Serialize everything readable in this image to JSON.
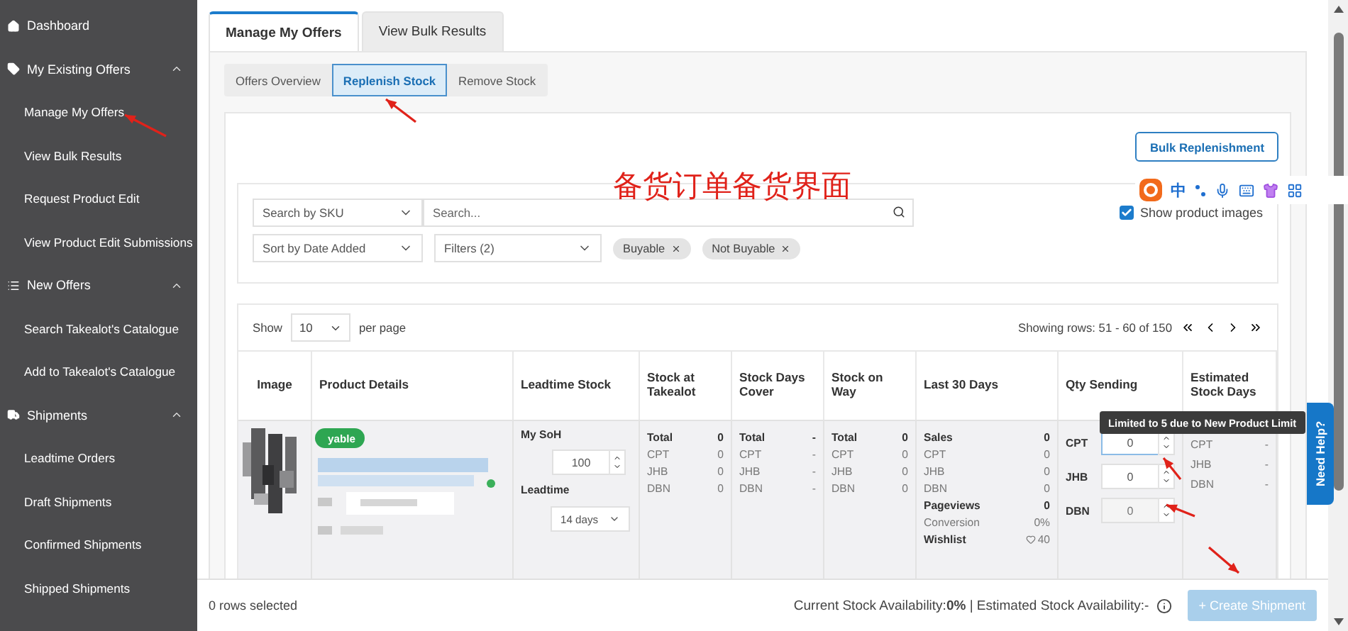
{
  "sidebar": {
    "items": [
      {
        "label": "Dashboard"
      },
      {
        "label": "My Existing Offers",
        "expanded": true,
        "children": [
          {
            "label": "Manage My Offers"
          },
          {
            "label": "View Bulk Results"
          },
          {
            "label": "Request Product Edit"
          },
          {
            "label": "View Product Edit Submissions"
          }
        ]
      },
      {
        "label": "New Offers",
        "expanded": true,
        "children": [
          {
            "label": "Search Takealot's Catalogue"
          },
          {
            "label": "Add to Takealot's Catalogue"
          }
        ]
      },
      {
        "label": "Shipments",
        "expanded": true,
        "children": [
          {
            "label": "Leadtime Orders"
          },
          {
            "label": "Draft Shipments"
          },
          {
            "label": "Confirmed Shipments"
          },
          {
            "label": "Shipped Shipments"
          }
        ]
      }
    ]
  },
  "tabs": [
    {
      "label": "Manage My Offers",
      "selected": true
    },
    {
      "label": "View Bulk Results",
      "selected": false
    }
  ],
  "subtabs": [
    {
      "label": "Offers Overview",
      "selected": false
    },
    {
      "label": "Replenish Stock",
      "selected": true
    },
    {
      "label": "Remove Stock",
      "selected": false
    }
  ],
  "bulk_button": "Bulk Replenishment",
  "annotation": "备货订单备货界面",
  "ime_toolbar": {
    "label": "中"
  },
  "filters": {
    "search_by": "Search by SKU",
    "search_placeholder": "Search...",
    "sort": "Sort by Date Added",
    "filter": "Filters (2)",
    "chips": [
      "Buyable",
      "Not Buyable"
    ],
    "show_images": {
      "label": "Show product images",
      "checked": true
    }
  },
  "pagination": {
    "show": "Show",
    "per_page_value": "10",
    "per_page": "per page",
    "rows_info": "Showing rows: 51 - 60 of 150"
  },
  "table": {
    "columns": [
      "Image",
      "Product Details",
      "Leadtime Stock",
      "Stock at Takealot",
      "Stock Days Cover",
      "Stock on Way",
      "Last 30 Days",
      "Qty Sending",
      "Estimated Stock Days"
    ],
    "rows": [
      {
        "badge": "yable",
        "soh_label": "My SoH",
        "soh": "100",
        "leadtime_label": "Leadtime",
        "leadtime": "14 days",
        "stock_at_takealot": [
          {
            "label": "Total",
            "value": "0",
            "bold": true
          },
          {
            "label": "CPT",
            "value": "0",
            "bold": false
          },
          {
            "label": "JHB",
            "value": "0",
            "bold": false
          },
          {
            "label": "DBN",
            "value": "0",
            "bold": false
          }
        ],
        "stock_days_cover": [
          {
            "label": "Total",
            "value": "-",
            "bold": true
          },
          {
            "label": "CPT",
            "value": "-",
            "bold": false
          },
          {
            "label": "JHB",
            "value": "-",
            "bold": false
          },
          {
            "label": "DBN",
            "value": "-",
            "bold": false
          }
        ],
        "stock_on_way": [
          {
            "label": "Total",
            "value": "0",
            "bold": true
          },
          {
            "label": "CPT",
            "value": "0",
            "bold": false
          },
          {
            "label": "JHB",
            "value": "0",
            "bold": false
          },
          {
            "label": "DBN",
            "value": "0",
            "bold": false
          }
        ],
        "last_30_days": [
          {
            "label": "Sales",
            "value": "0",
            "bold": true,
            "kind": "plain"
          },
          {
            "label": "CPT",
            "value": "0",
            "bold": false,
            "kind": "plain"
          },
          {
            "label": "JHB",
            "value": "0",
            "bold": false,
            "kind": "plain"
          },
          {
            "label": "DBN",
            "value": "0",
            "bold": false,
            "kind": "plain"
          },
          {
            "label": "Pageviews",
            "value": "0",
            "bold": true,
            "kind": "plain"
          },
          {
            "label": "Conversion",
            "value": "0%",
            "bold": false,
            "kind": "plain"
          },
          {
            "label": "Wishlist",
            "value": "40",
            "bold": true,
            "kind": "heart"
          }
        ],
        "qty_sending": [
          {
            "label": "CPT",
            "value": "0",
            "focused": true,
            "disabled": false
          },
          {
            "label": "JHB",
            "value": "0",
            "focused": false,
            "disabled": false
          },
          {
            "label": "DBN",
            "value": "0",
            "focused": false,
            "disabled": true
          }
        ],
        "estimated_stock_days": [
          {
            "label": "CPT",
            "value": "-"
          },
          {
            "label": "JHB",
            "value": "-"
          },
          {
            "label": "DBN",
            "value": "-"
          }
        ]
      }
    ]
  },
  "tooltip": "Limited to 5 due to New Product Limit",
  "help_tab": "Need Help?",
  "footer": {
    "selected": "0 rows selected",
    "availability": "Current Stock Availability:**0%** | Estimated Stock Availability:-",
    "create_button": {
      "label": "+ Create Shipment",
      "disabled": true
    }
  }
}
